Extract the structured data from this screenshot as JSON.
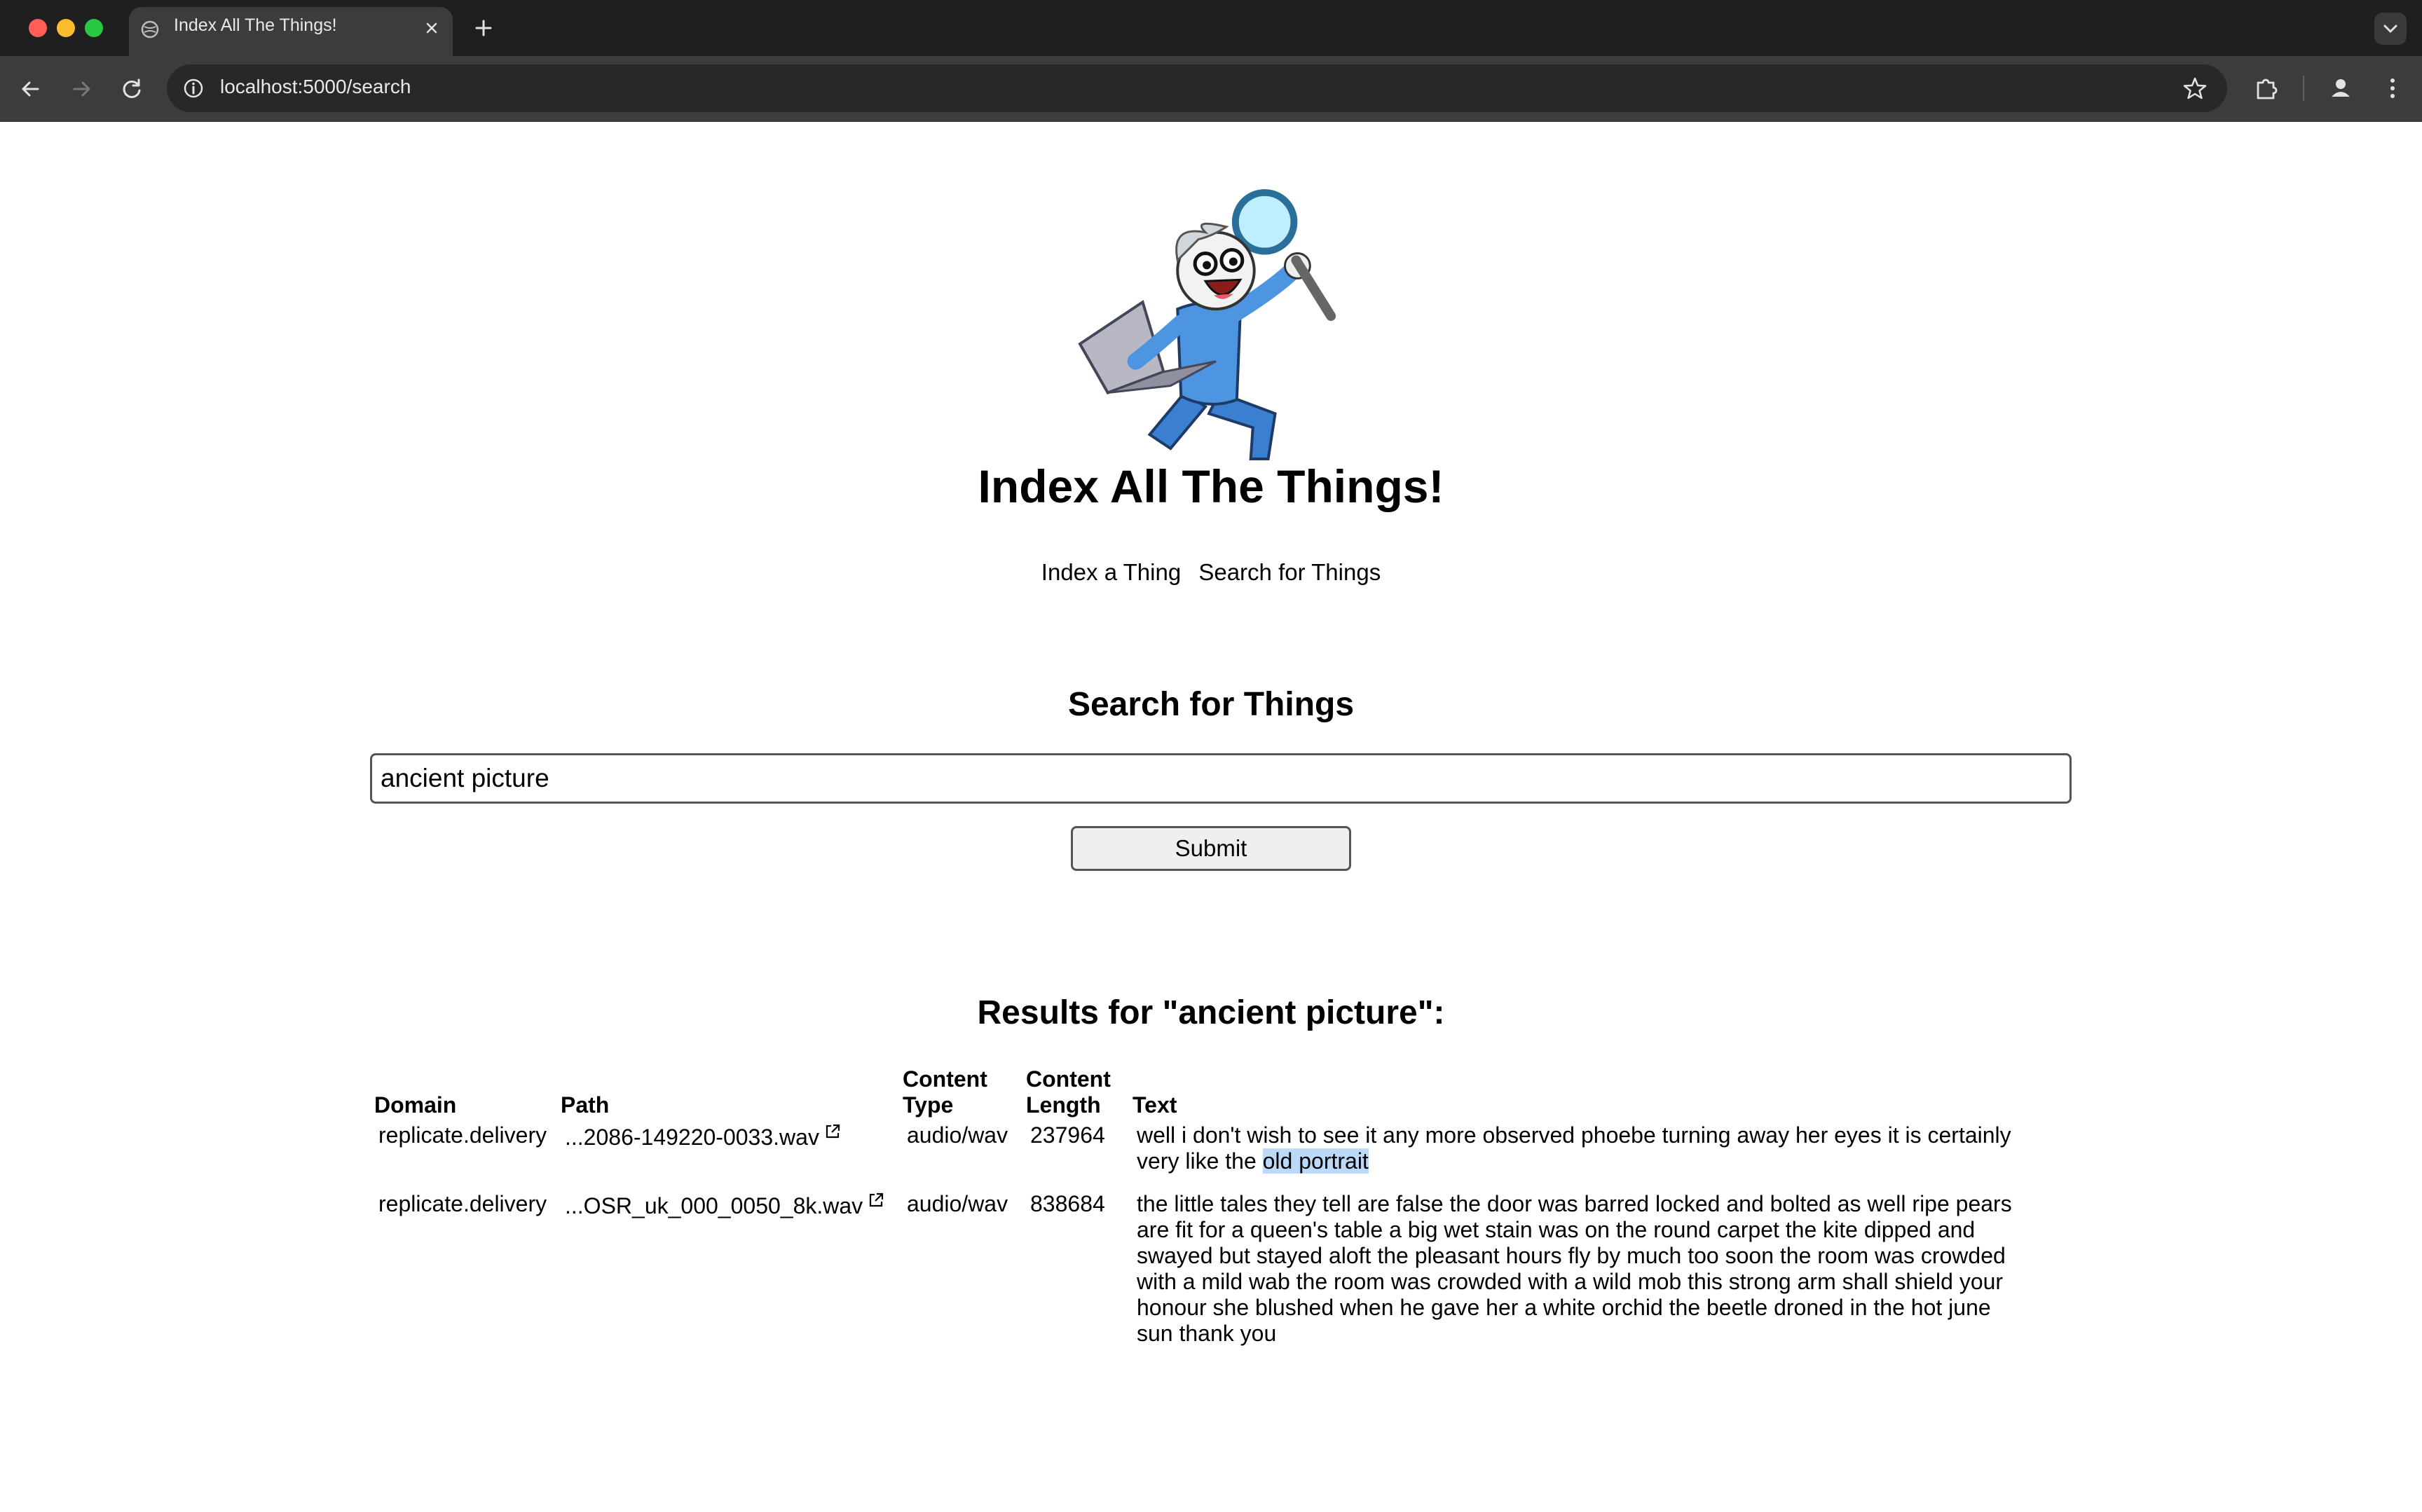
{
  "browser": {
    "tab_title": "Index All The Things!",
    "url": "localhost:5000/search"
  },
  "site": {
    "title": "Index All The Things!",
    "nav": [
      "Index a Thing",
      "Search for Things"
    ]
  },
  "search": {
    "heading": "Search for Things",
    "query": "ancient picture",
    "submit_label": "Submit"
  },
  "results": {
    "heading": "Results for \"ancient picture\":",
    "columns": {
      "domain": "Domain",
      "path": "Path",
      "content_type_1": "Content",
      "content_type_2": "Type",
      "content_length_1": "Content",
      "content_length_2": "Length",
      "text": "Text"
    },
    "rows": [
      {
        "domain": "replicate.delivery",
        "path": "...2086-149220-0033.wav",
        "content_type": "audio/wav",
        "content_length": "237964",
        "text_before": "well i don't wish to see it any more observed phoebe turning away her eyes it is certainly very like the ",
        "text_highlight": "old portrait",
        "text_after": ""
      },
      {
        "domain": "replicate.delivery",
        "path": "...OSR_uk_000_0050_8k.wav",
        "content_type": "audio/wav",
        "content_length": "838684",
        "text_before": "the little tales they tell are false the door was barred locked and bolted as well ripe pears are fit for a queen's table a big wet stain was on the round carpet the kite dipped and swayed but stayed aloft the pleasant hours fly by much too soon the room was crowded with a mild wab the room was crowded with a wild mob this strong arm shall shield your honour she blushed when he gave her a white orchid the beetle droned in the hot june sun thank you",
        "text_highlight": "",
        "text_after": ""
      }
    ]
  },
  "colors": {
    "chrome_dark": "#1f1f1f",
    "toolbar": "#3c3c3c",
    "highlight": "#bcd9f7"
  },
  "icons": [
    "site-favicon-icon",
    "close-icon",
    "plus-icon",
    "chevron-down-icon",
    "back-arrow-icon",
    "forward-arrow-icon",
    "reload-icon",
    "info-icon",
    "star-icon",
    "puzzle-icon",
    "profile-icon",
    "more-vert-icon",
    "external-link-icon"
  ]
}
